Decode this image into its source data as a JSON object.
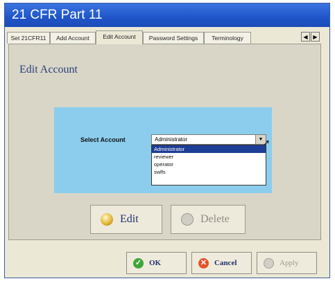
{
  "window": {
    "title": "21 CFR Part 11"
  },
  "tabs": [
    {
      "label": "Set 21CFR11",
      "active": false
    },
    {
      "label": "Add Account",
      "active": false
    },
    {
      "label": "Edit Account",
      "active": true
    },
    {
      "label": "Password Settings",
      "active": false
    },
    {
      "label": "Terminology",
      "active": false
    }
  ],
  "tab_scroll": {
    "left": "◀",
    "right": "▶"
  },
  "panel": {
    "title": "Edit Account"
  },
  "select_account": {
    "label": "Select Account",
    "value": "Administrator",
    "options": [
      "Administrator",
      "reviewer",
      "operator",
      "swlfs"
    ],
    "selected_index": 0
  },
  "actions": {
    "edit_label": "Edit",
    "delete_label": "Delete"
  },
  "dialog_buttons": {
    "ok_label": "OK",
    "cancel_label": "Cancel",
    "apply_label": "Apply"
  },
  "colors": {
    "titlebar": "#1f55c9",
    "selection": "#1d3e96",
    "panel_accent": "#8ccdee"
  }
}
